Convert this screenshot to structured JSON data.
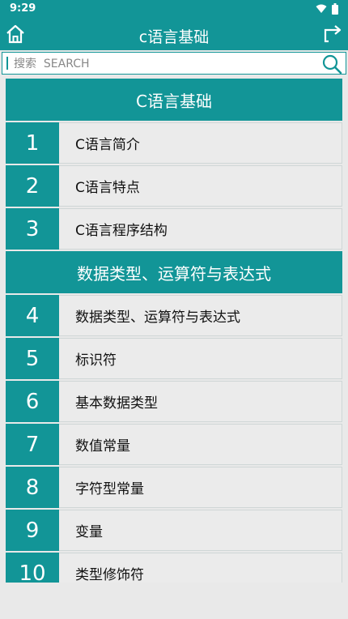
{
  "status": {
    "time": "9:29"
  },
  "header": {
    "title": "c语言基础"
  },
  "search": {
    "placeholder": "搜索  SEARCH"
  },
  "sections": [
    {
      "title": "C语言基础",
      "items": [
        {
          "num": "1",
          "label": "C语言简介"
        },
        {
          "num": "2",
          "label": "C语言特点"
        },
        {
          "num": "3",
          "label": "C语言程序结构"
        }
      ]
    },
    {
      "title": "数据类型、运算符与表达式",
      "items": [
        {
          "num": "4",
          "label": "数据类型、运算符与表达式"
        },
        {
          "num": "5",
          "label": "标识符"
        },
        {
          "num": "6",
          "label": "基本数据类型"
        },
        {
          "num": "7",
          "label": "数值常量"
        },
        {
          "num": "8",
          "label": "字符型常量"
        },
        {
          "num": "9",
          "label": "变量"
        },
        {
          "num": "10",
          "label": "类型修饰符"
        }
      ]
    }
  ],
  "colors": {
    "accent": "#129597",
    "row_bg": "#ebebeb",
    "page_bg": "#e9e9e9"
  },
  "icons": {
    "home": "home-icon",
    "share": "share-icon",
    "search": "search-icon",
    "wifi": "wifi-icon",
    "battery": "battery-icon"
  }
}
